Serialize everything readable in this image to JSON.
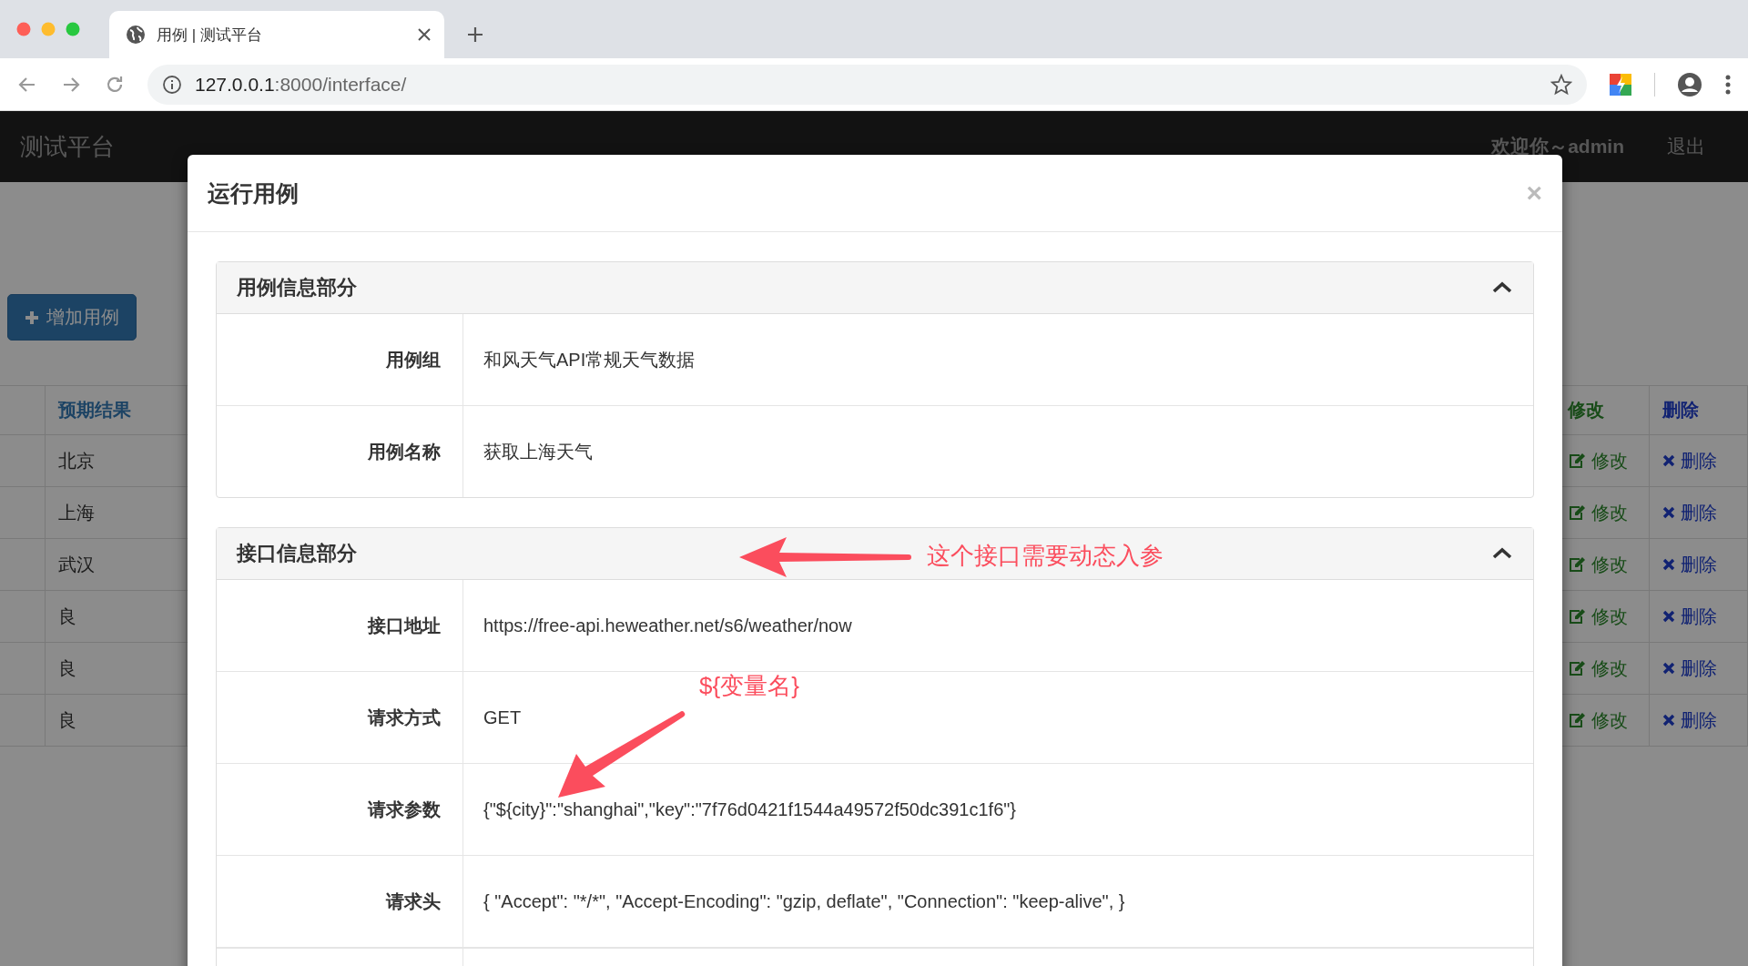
{
  "browser": {
    "tab_title": "用例 | 测试平台",
    "url_host": "127.0.0.1",
    "url_path": ":8000/interface/"
  },
  "navbar": {
    "brand": "测试平台",
    "welcome": "欢迎你～admin",
    "logout": "退出"
  },
  "background": {
    "add_button": "增加用例",
    "columns": [
      "预期结果",
      "修改",
      "删除"
    ],
    "rows": [
      {
        "result": "北京",
        "edit": "修改",
        "delete": "删除"
      },
      {
        "result": "上海",
        "edit": "修改",
        "delete": "删除"
      },
      {
        "result": "武汉",
        "edit": "修改",
        "delete": "删除"
      },
      {
        "result": "良",
        "edit": "修改",
        "delete": "删除"
      },
      {
        "result": "良",
        "edit": "修改",
        "delete": "删除"
      },
      {
        "result": "良",
        "edit": "修改",
        "delete": "删除"
      }
    ]
  },
  "modal": {
    "title": "运行用例",
    "close": "×",
    "panels": [
      {
        "title": "用例信息部分",
        "expanded": true,
        "fields": [
          {
            "label": "用例组",
            "value": "和风天气API常规天气数据"
          },
          {
            "label": "用例名称",
            "value": "获取上海天气"
          }
        ]
      },
      {
        "title": "接口信息部分",
        "expanded": true,
        "fields": [
          {
            "label": "接口地址",
            "value": "https://free-api.heweather.net/s6/weather/now"
          },
          {
            "label": "请求方式",
            "value": "GET"
          },
          {
            "label": "请求参数",
            "value": "{\"${city}\":\"shanghai\",\"key\":\"7f76d0421f1544a49572f50dc391c1f6\"}"
          },
          {
            "label": "请求头",
            "value": "{ \"Accept\": \"*/*\", \"Accept-Encoding\": \"gzip, deflate\", \"Connection\": \"keep-alive\", }"
          }
        ]
      }
    ]
  },
  "annotations": [
    {
      "kind": "left-arrow",
      "text": "这个接口需要动态入参"
    },
    {
      "kind": "down-left-arrow",
      "text": "${变量名}"
    }
  ]
}
